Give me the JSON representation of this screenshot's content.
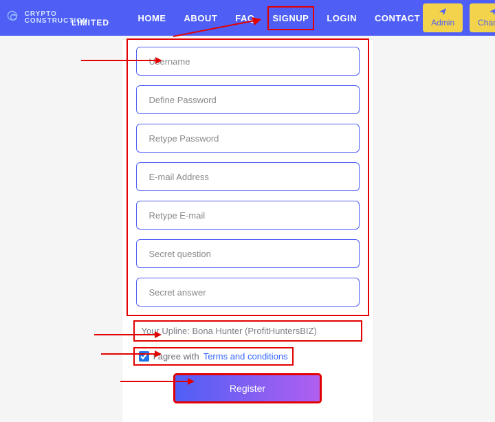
{
  "header": {
    "logo_line1": "CRYPTO CONSTRUCTION",
    "logo_line2": "LIMITED",
    "nav": {
      "home": "HOME",
      "about": "ABOUT",
      "faq": "FAQ",
      "signup": "SIGNUP",
      "login": "LOGIN",
      "contact": "CONTACT"
    },
    "buttons": {
      "admin": "Admin",
      "channel": "Channel"
    }
  },
  "form": {
    "username_ph": "Username",
    "password_ph": "Define Password",
    "retype_password_ph": "Retype Password",
    "email_ph": "E-mail Address",
    "retype_email_ph": "Retype E-mail",
    "secret_q_ph": "Secret question",
    "secret_a_ph": "Secret answer"
  },
  "upline_text": "Your Upline: Bona Hunter (ProfitHuntersBIZ)",
  "agree_text": "I agree with ",
  "terms_link": "Terms and conditions",
  "register_label": "Register",
  "colors": {
    "brand": "#4f5ff5",
    "highlight": "#e20000",
    "button_yellow": "#f2d34b"
  }
}
